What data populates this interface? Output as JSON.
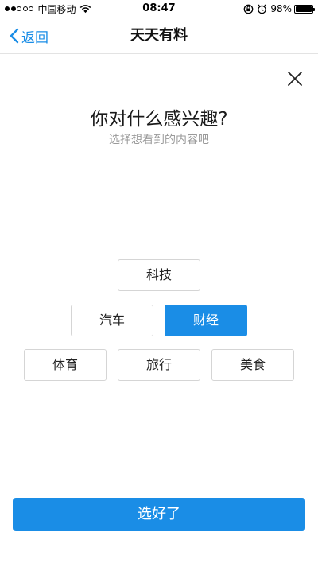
{
  "status_bar": {
    "carrier": "中国移动",
    "time": "08:47",
    "battery": "98%",
    "battery_level": 0.98,
    "signal_bars": 2,
    "icons": [
      "signal-icon",
      "wifi-icon",
      "rotation-lock-icon",
      "alarm-icon",
      "battery-icon"
    ]
  },
  "nav": {
    "back_label": "返回",
    "title": "天天有料"
  },
  "prompt": {
    "title": "你对什么感兴趣?",
    "subtitle": "选择想看到的内容吧"
  },
  "tags": [
    {
      "label": "科技",
      "selected": false
    },
    {
      "label": "汽车",
      "selected": false
    },
    {
      "label": "财经",
      "selected": true
    },
    {
      "label": "体育",
      "selected": false
    },
    {
      "label": "旅行",
      "selected": false
    },
    {
      "label": "美食",
      "selected": false
    }
  ],
  "confirm_label": "选好了",
  "colors": {
    "accent": "#1a8de6",
    "subtitle": "#9a9a9a",
    "tag_border": "#d5d5d5"
  }
}
